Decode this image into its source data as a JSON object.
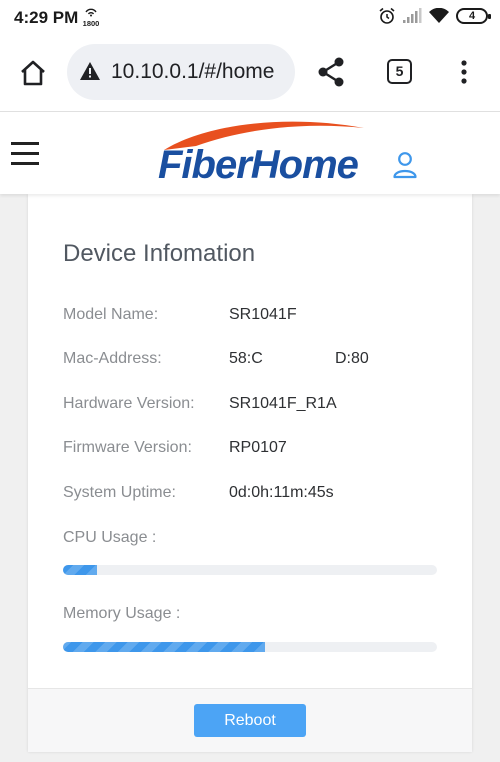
{
  "status_bar": {
    "time": "4:29 PM",
    "hotspot_speed": "1800",
    "battery": "4",
    "icons": [
      "hotspot-icon",
      "alarm-icon",
      "signal-icon",
      "wifi-icon",
      "battery-icon"
    ]
  },
  "browser": {
    "url": "10.10.0.1/#/home",
    "tab_count": "5",
    "icons": [
      "home-icon",
      "warning-icon",
      "share-icon",
      "tabs-icon",
      "more-vert-icon"
    ]
  },
  "header": {
    "logo_text": "FiberHome",
    "icons": [
      "hamburger-menu-icon",
      "user-icon"
    ]
  },
  "device_info": {
    "title": "Device Infomation",
    "rows": [
      {
        "label": "Model Name:",
        "value": "SR1041F"
      },
      {
        "label": "Mac-Address:",
        "value": "58:C",
        "value_end": "D:80"
      },
      {
        "label": "Hardware Version:",
        "value": "SR1041F_R1A"
      },
      {
        "label": "Firmware Version:",
        "value": "RP0107"
      },
      {
        "label": "System Uptime:",
        "value": "0d:0h:11m:45s"
      }
    ],
    "cpu": {
      "label": "CPU Usage :",
      "percent": 9
    },
    "memory": {
      "label": "Memory Usage :",
      "percent": 54
    }
  },
  "actions": {
    "reboot_label": "Reboot"
  },
  "colors": {
    "accent": "#4ca4f5",
    "logo_blue": "#1a4fa0",
    "logo_swoosh": "#e8501f",
    "progress": "#3e97eb"
  }
}
